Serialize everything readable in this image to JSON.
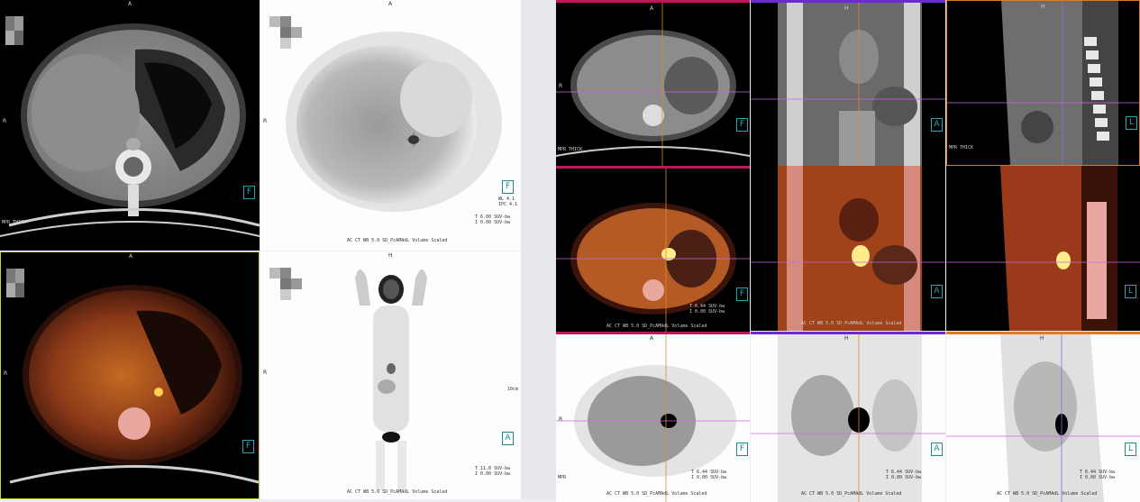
{
  "panels": [
    {
      "id": "ct-axial-1",
      "top": "A",
      "left": "R",
      "bottom_left": "MPR THICK",
      "badge": "F"
    },
    {
      "id": "pet-axial-1",
      "top": "A",
      "left": "R",
      "badge": "F",
      "wl": "WL 4.1\nIPC 4.1",
      "suv": "T 6.00 SUV-bw\nI 0.00 SUV-bw",
      "footer": "AC CT WB 5.0 SD_PcAMAdL Volume Scaled"
    },
    {
      "id": "fusion-axial-1",
      "top": "A",
      "left": "R",
      "badge": "F"
    },
    {
      "id": "pet-mip",
      "top": "H",
      "left": "R",
      "badge": "A",
      "suv": "T 11.0 SUV-bw\nI 0.00 SUV-bw",
      "footer": "AC CT WB 5.0 SD_PcAMAdL Volume Scaled",
      "scale": "10cm"
    },
    {
      "id": "ct-axial-2",
      "top": "A",
      "left": "R",
      "badge": "F",
      "bottom_left": "MPR THICK"
    },
    {
      "id": "ct-coronal",
      "top": "H",
      "badge": "A"
    },
    {
      "id": "ct-sagittal",
      "top": "H",
      "badge": "L",
      "bottom_left": "MPR THICK"
    },
    {
      "id": "fusion-axial-2",
      "top": "",
      "badge": "F",
      "suv": "T 6.44 SUV-bw\nI 0.00 SUV-bw",
      "footer": "AC CT WB 5.0 SD_PcAMAdL Volume Scaled"
    },
    {
      "id": "fusion-coronal",
      "badge": "A",
      "footer": "AC CT WB 5.0 SD_PcAMAdL Volume Scaled"
    },
    {
      "id": "fusion-sagittal",
      "badge": "L"
    },
    {
      "id": "pet-axial-2",
      "top": "A",
      "left": "R",
      "badge": "F",
      "bottom_left": "MPR",
      "suv": "T 6.44 SUV-bw\nI 0.00 SUV-bw",
      "footer": "AC CT WB 5.0 SD_PcAMAdL Volume Scaled"
    },
    {
      "id": "pet-coronal",
      "top": "H",
      "badge": "A",
      "suv": "T 6.44 SUV-bw\nI 0.00 SUV-bw",
      "footer": "AC CT WB 5.0 SD_PcAMAdL Volume Scaled"
    },
    {
      "id": "pet-sagittal",
      "top": "H",
      "badge": "L",
      "suv": "T 6.44 SUV-bw\nI 0.00 SUV-bw",
      "footer": "AC CT WB 5.0 SD_PcAMAdL Volume Scaled"
    }
  ]
}
